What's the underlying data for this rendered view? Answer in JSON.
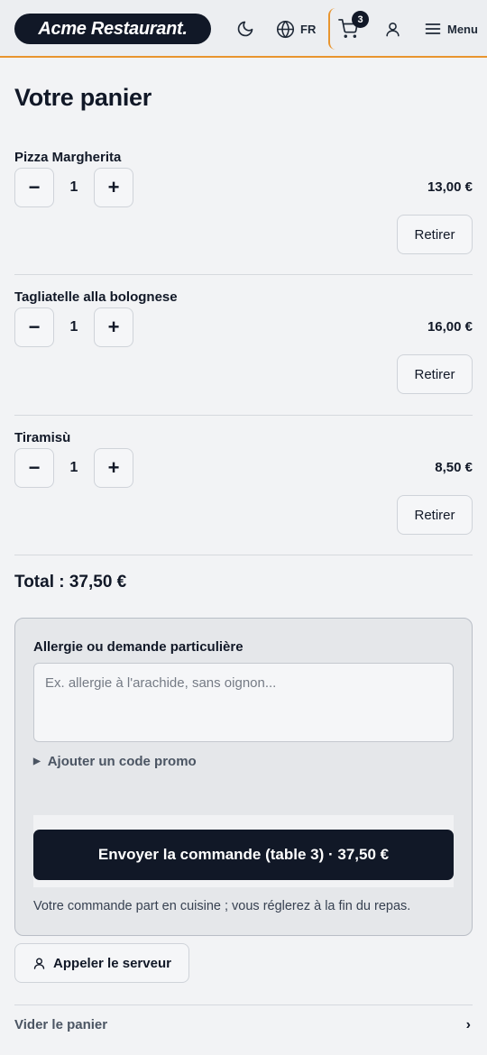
{
  "header": {
    "logo": "Acme Restaurant.",
    "language": "FR",
    "cart_count": "3",
    "menu_label": "Menu"
  },
  "page_title": "Votre panier",
  "cart": {
    "items": [
      {
        "name": "Pizza Margherita",
        "qty": "1",
        "price": "13,00 €",
        "remove_label": "Retirer"
      },
      {
        "name": "Tagliatelle alla bolognese",
        "qty": "1",
        "price": "16,00 €",
        "remove_label": "Retirer"
      },
      {
        "name": "Tiramisù",
        "qty": "1",
        "price": "8,50 €",
        "remove_label": "Retirer"
      }
    ],
    "minus": "−",
    "plus": "+",
    "total": "Total : 37,50 €"
  },
  "order_panel": {
    "allergy_label": "Allergie ou demande particulière",
    "allergy_placeholder": "Ex. allergie à l'arachide, sans oignon...",
    "promo_label": "Ajouter un code promo",
    "send_button": "Envoyer la commande (table 3) · 37,50 €",
    "note": "Votre commande part en cuisine ; vous réglerez à la fin du repas."
  },
  "call_waiter": "Appeler le serveur",
  "clear_cart": "Vider le panier",
  "colors": {
    "accent": "#e8952f",
    "dark": "#111827",
    "background": "#f2f3f5"
  }
}
